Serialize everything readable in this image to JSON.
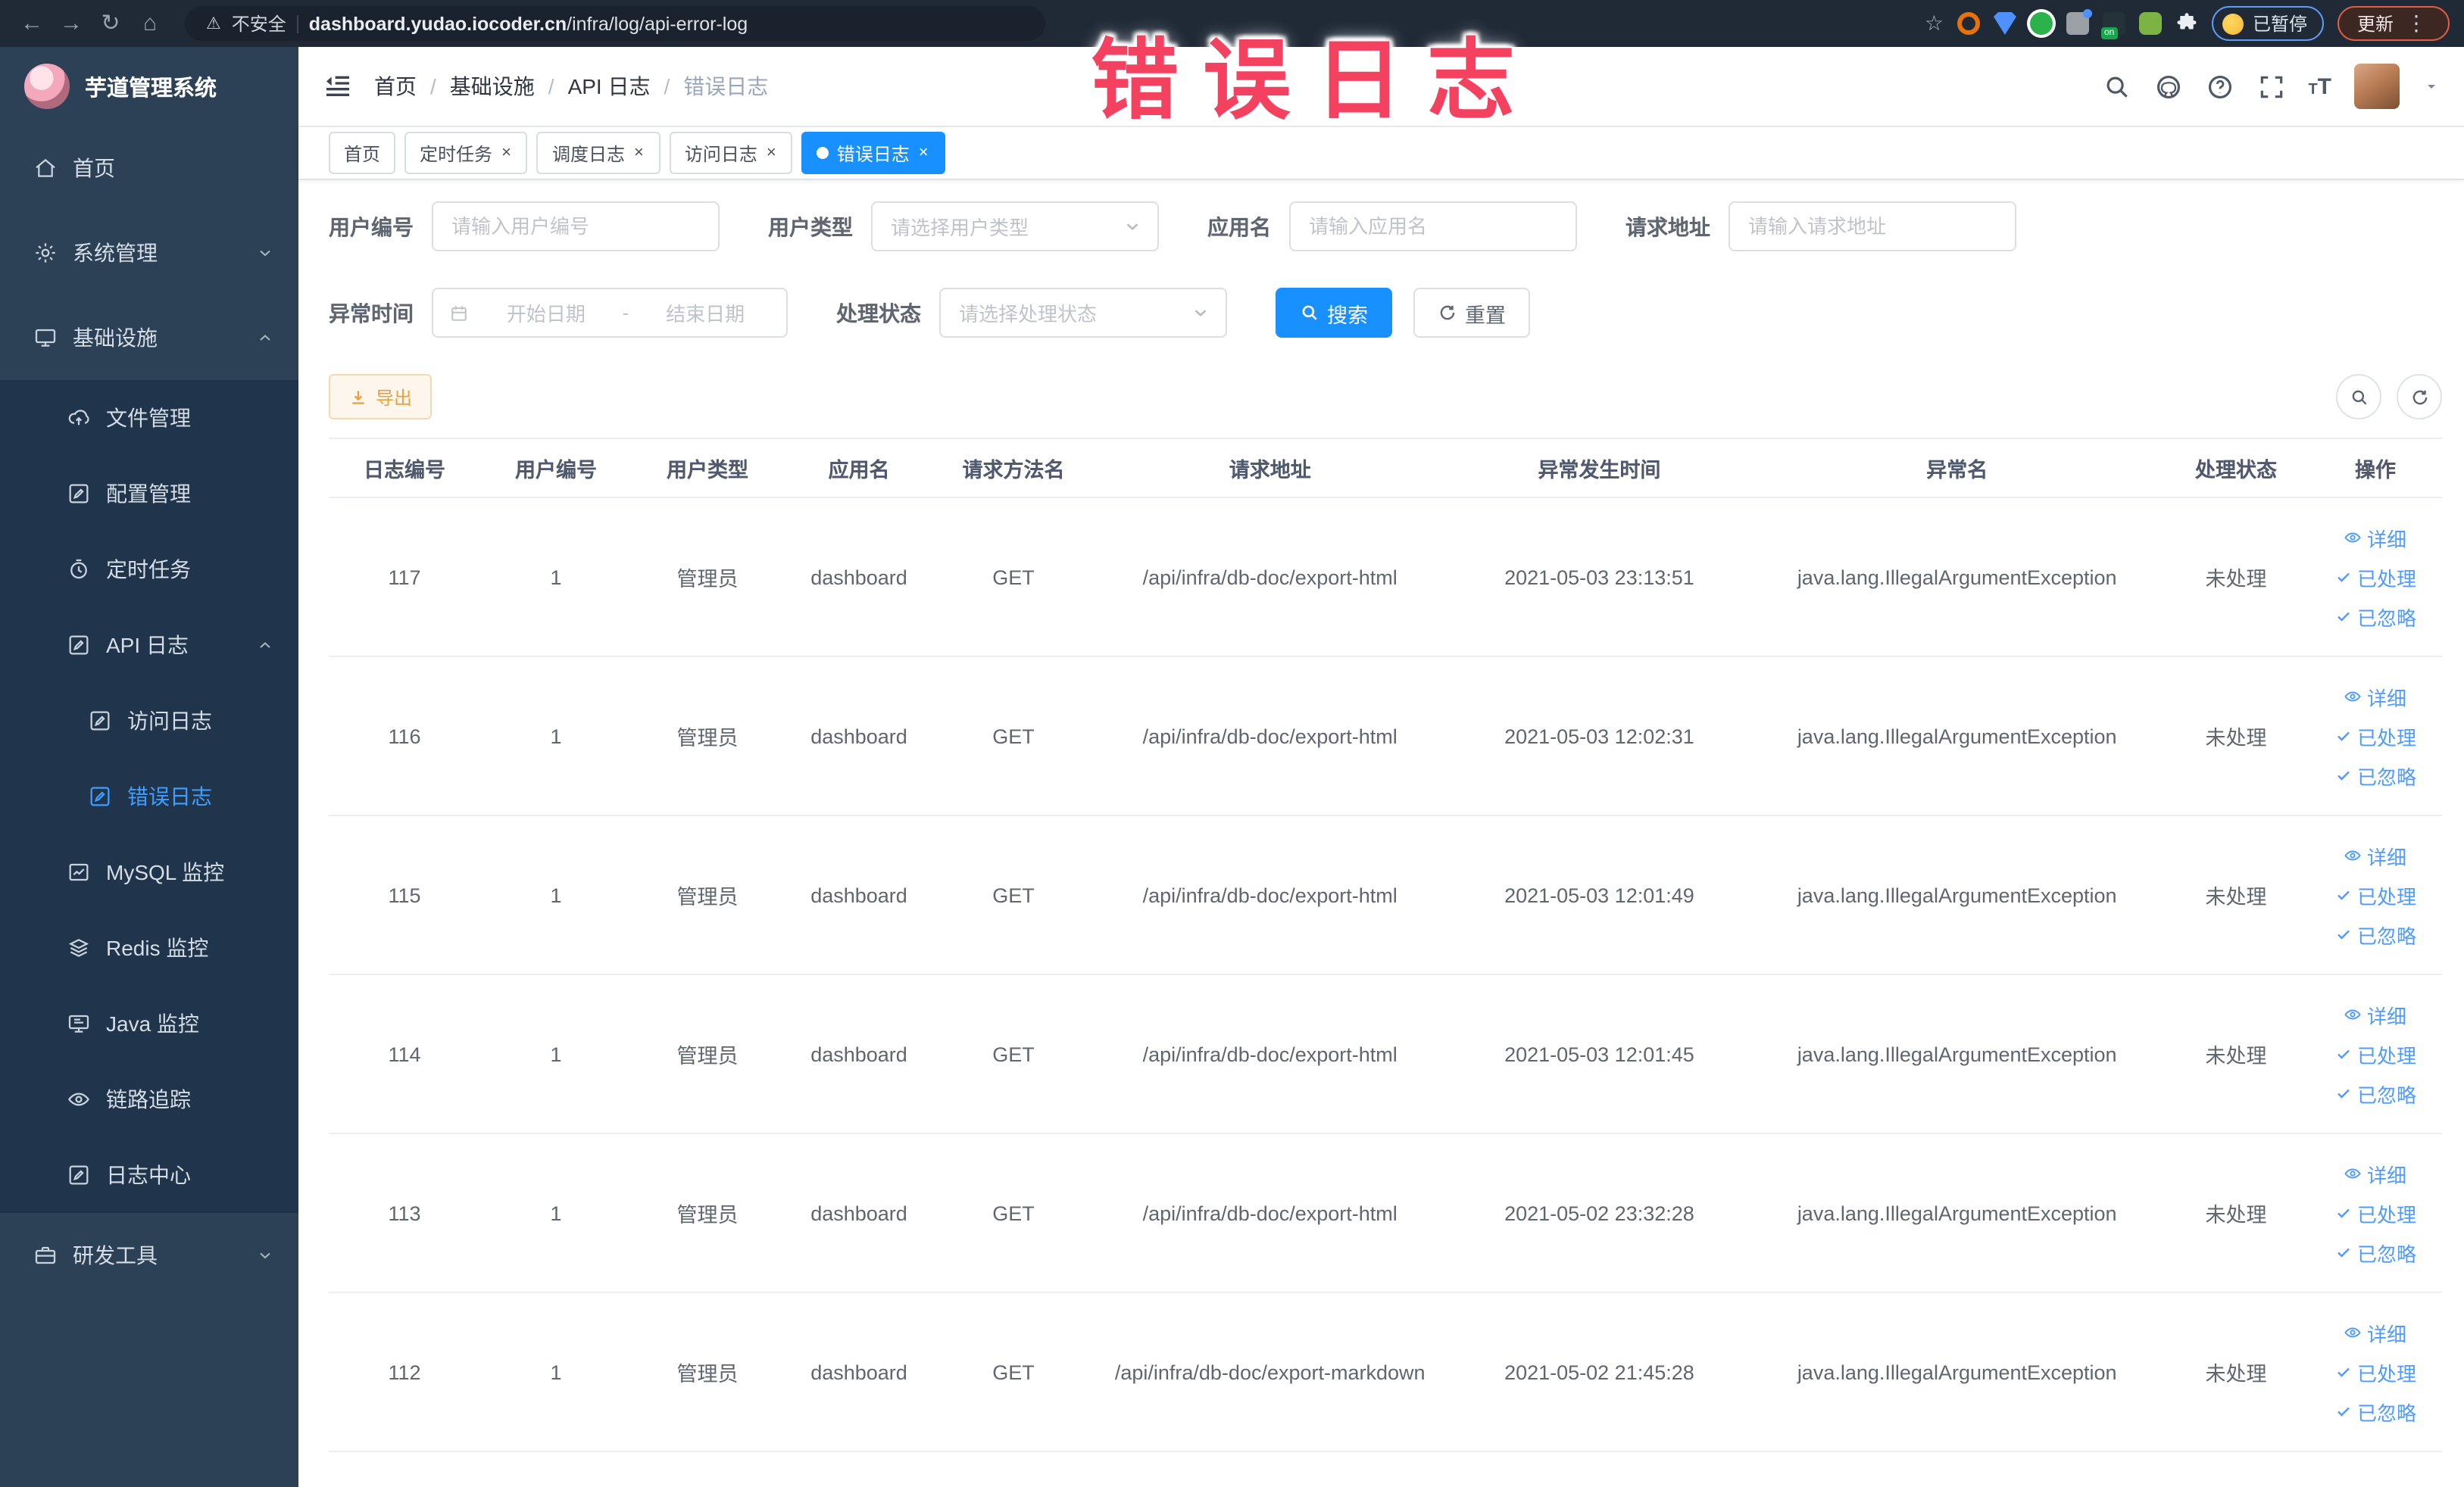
{
  "icons": {
    "back": "←",
    "forward": "→",
    "reload": "↻",
    "home": "⌂",
    "warning": "⚠",
    "star": "☆",
    "menu_dots": "⋮",
    "breadcrumb_sep": "/",
    "close": "×",
    "ext_badge": "on",
    "font_size_large": "T",
    "font_size_small": "T"
  },
  "browser": {
    "security_label": "不安全",
    "url_domain": "dashboard.yudao.iocoder.cn",
    "url_path": "/infra/log/api-error-log",
    "paused_label": "已暂停",
    "update_label": "更新"
  },
  "annotation": {
    "text": "错误日志",
    "color": "#f4415f"
  },
  "sidebar": {
    "title": "芋道管理系统",
    "items": [
      {
        "label": "首页",
        "icon": "home",
        "level": 1
      },
      {
        "label": "系统管理",
        "icon": "gear",
        "level": 1,
        "arrow": "down"
      },
      {
        "label": "基础设施",
        "icon": "monitor",
        "level": 1,
        "arrow": "up"
      },
      {
        "label": "文件管理",
        "icon": "cloud",
        "level": 2,
        "sub": true
      },
      {
        "label": "配置管理",
        "icon": "edit",
        "level": 2,
        "sub": true
      },
      {
        "label": "定时任务",
        "icon": "timer",
        "level": 2,
        "sub": true
      },
      {
        "label": "API 日志",
        "icon": "log",
        "level": 2,
        "sub": true,
        "arrow": "up"
      },
      {
        "label": "访问日志",
        "icon": "log",
        "level": 3,
        "sub": true
      },
      {
        "label": "错误日志",
        "icon": "log",
        "level": 3,
        "sub": true,
        "active": true
      },
      {
        "label": "MySQL 监控",
        "icon": "chart",
        "level": 2,
        "sub": true
      },
      {
        "label": "Redis 监控",
        "icon": "stack",
        "level": 2,
        "sub": true
      },
      {
        "label": "Java 监控",
        "icon": "java",
        "level": 2,
        "sub": true
      },
      {
        "label": "链路追踪",
        "icon": "eye",
        "level": 2,
        "sub": true
      },
      {
        "label": "日志中心",
        "icon": "log",
        "level": 2,
        "sub": true
      },
      {
        "label": "研发工具",
        "icon": "tool",
        "level": 1,
        "arrow": "down"
      }
    ]
  },
  "header": {
    "breadcrumb": [
      "首页",
      "基础设施",
      "API 日志",
      "错误日志"
    ]
  },
  "tabs": [
    {
      "label": "首页"
    },
    {
      "label": "定时任务",
      "closable": true
    },
    {
      "label": "调度日志",
      "closable": true
    },
    {
      "label": "访问日志",
      "closable": true
    },
    {
      "label": "错误日志",
      "closable": true,
      "active": true
    }
  ],
  "filters": {
    "user_id": {
      "label": "用户编号",
      "placeholder": "请输入用户编号"
    },
    "user_type": {
      "label": "用户类型",
      "placeholder": "请选择用户类型"
    },
    "app_name": {
      "label": "应用名",
      "placeholder": "请输入应用名"
    },
    "request_url": {
      "label": "请求地址",
      "placeholder": "请输入请求地址"
    },
    "exception_time": {
      "label": "异常时间",
      "start_placeholder": "开始日期",
      "separator": "-",
      "end_placeholder": "结束日期"
    },
    "process_status": {
      "label": "处理状态",
      "placeholder": "请选择处理状态"
    },
    "search_label": "搜索",
    "reset_label": "重置"
  },
  "toolbar": {
    "export_label": "导出"
  },
  "table": {
    "columns": [
      "日志编号",
      "用户编号",
      "用户类型",
      "应用名",
      "请求方法名",
      "请求地址",
      "异常发生时间",
      "异常名",
      "处理状态",
      "操作"
    ],
    "actions": {
      "detail": "详细",
      "processed": "已处理",
      "ignored": "已忽略"
    },
    "rows": [
      {
        "id": "117",
        "user_id": "1",
        "user_type": "管理员",
        "app": "dashboard",
        "method": "GET",
        "url": "/api/infra/db-doc/export-html",
        "time": "2021-05-03 23:13:51",
        "exception": "java.lang.IllegalArgumentException",
        "status": "未处理"
      },
      {
        "id": "116",
        "user_id": "1",
        "user_type": "管理员",
        "app": "dashboard",
        "method": "GET",
        "url": "/api/infra/db-doc/export-html",
        "time": "2021-05-03 12:02:31",
        "exception": "java.lang.IllegalArgumentException",
        "status": "未处理"
      },
      {
        "id": "115",
        "user_id": "1",
        "user_type": "管理员",
        "app": "dashboard",
        "method": "GET",
        "url": "/api/infra/db-doc/export-html",
        "time": "2021-05-03 12:01:49",
        "exception": "java.lang.IllegalArgumentException",
        "status": "未处理"
      },
      {
        "id": "114",
        "user_id": "1",
        "user_type": "管理员",
        "app": "dashboard",
        "method": "GET",
        "url": "/api/infra/db-doc/export-html",
        "time": "2021-05-03 12:01:45",
        "exception": "java.lang.IllegalArgumentException",
        "status": "未处理"
      },
      {
        "id": "113",
        "user_id": "1",
        "user_type": "管理员",
        "app": "dashboard",
        "method": "GET",
        "url": "/api/infra/db-doc/export-html",
        "time": "2021-05-02 23:32:28",
        "exception": "java.lang.IllegalArgumentException",
        "status": "未处理"
      },
      {
        "id": "112",
        "user_id": "1",
        "user_type": "管理员",
        "app": "dashboard",
        "method": "GET",
        "url": "/api/infra/db-doc/export-markdown",
        "time": "2021-05-02 21:45:28",
        "exception": "java.lang.IllegalArgumentException",
        "status": "未处理"
      }
    ]
  }
}
